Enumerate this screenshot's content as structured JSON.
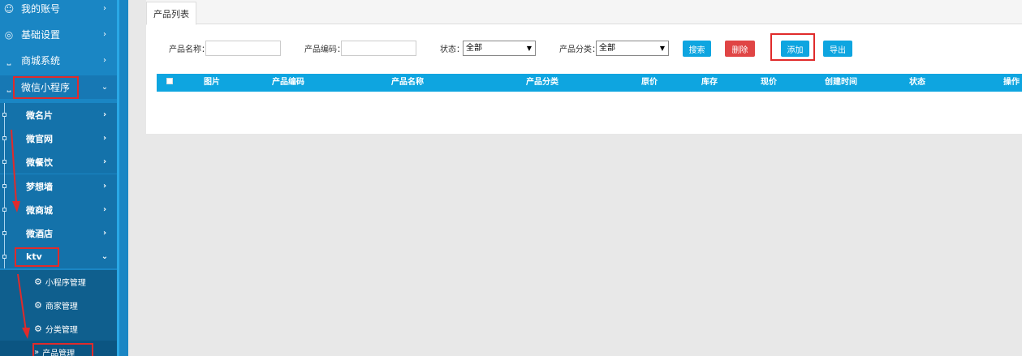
{
  "sidebar": {
    "top_items": [
      {
        "label": "我的账号",
        "icon": "user-icon"
      },
      {
        "label": "基础设置",
        "icon": "globe-icon"
      },
      {
        "label": "商城系统",
        "icon": "cart-icon"
      },
      {
        "label": "微信小程序",
        "icon": "cart-icon"
      }
    ],
    "sub_items": [
      "微名片",
      "微官网",
      "微餐饮",
      "梦想墙",
      "微商城",
      "微酒店",
      "ktv"
    ],
    "leaf_items": [
      "小程序管理",
      "商家管理",
      "分类管理",
      "产品管理"
    ],
    "chev_right": "›",
    "chev_down": "⌄",
    "leaf_active_prefix": "»"
  },
  "tabs": {
    "product_list": "产品列表"
  },
  "filters": {
    "product_name_label": "产品名称：",
    "product_code_label": "产品编码：",
    "status_label": "状态：",
    "status_value": "全部",
    "category_label": "产品分类：",
    "category_value": "全部"
  },
  "buttons": {
    "search": "搜索",
    "delete": "删除",
    "add": "添加",
    "export": "导出"
  },
  "table": {
    "columns": [
      "图片",
      "产品编码",
      "产品名称",
      "产品分类",
      "原价",
      "库存",
      "现价",
      "创建时间",
      "状态",
      "操作"
    ]
  },
  "colors": {
    "sidebar_blue": "#1a86c4",
    "accent": "#0ea5e0",
    "danger": "#e04545",
    "highlight": "#e02b2b"
  }
}
